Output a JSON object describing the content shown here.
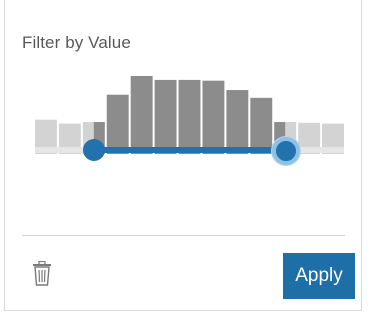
{
  "filter": {
    "title": "Filter by Value",
    "colors": {
      "selected_bar": "#8c8c8c",
      "unselected_bar": "#d3d3d3",
      "track": "#2371ad",
      "handle_ring": "#8ec1e6"
    },
    "histogram": {
      "bin_heights": [
        0.44,
        0.39,
        0.41,
        0.76,
        1.0,
        0.95,
        0.95,
        0.94,
        0.82,
        0.72,
        0.41,
        0.4,
        0.39
      ],
      "selected": [
        false,
        false,
        "partial",
        true,
        true,
        true,
        true,
        true,
        true,
        true,
        "partial",
        false,
        false
      ],
      "range_selected": [
        0.19,
        0.81
      ]
    }
  },
  "footer": {
    "delete_icon": "trash-icon",
    "apply_label": "Apply"
  }
}
